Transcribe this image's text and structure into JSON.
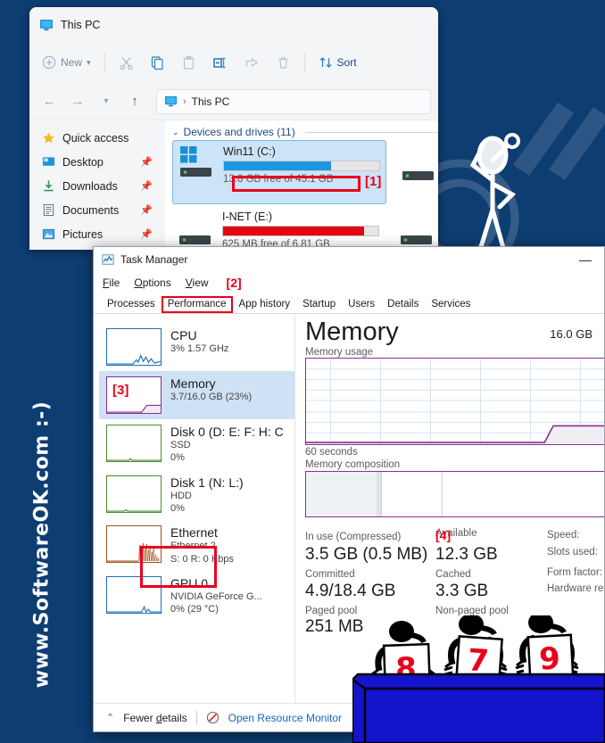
{
  "background": {
    "color": "#0e3d72",
    "watermark_vertical": "www.SoftwareOK.com  :-)"
  },
  "explorer": {
    "title": "This PC",
    "title_icon": "monitor-icon",
    "toolbar": {
      "new_label": "New",
      "new_icon": "plus-circle-icon",
      "new_chevron": "chevron-down-icon",
      "cut_icon": "scissors-icon",
      "copy_icon": "copy-icon",
      "paste_icon": "clipboard-icon",
      "rename_icon": "rename-icon",
      "share_icon": "share-icon",
      "delete_icon": "trash-icon",
      "sort_label": "Sort",
      "sort_icon": "sort-arrows-icon"
    },
    "nav": {
      "back_icon": "arrow-left-icon",
      "forward_icon": "arrow-right-icon",
      "recent_icon": "chevron-down-icon",
      "up_icon": "arrow-up-icon",
      "address_icon": "monitor-icon",
      "address_separator": "›",
      "address_text": "This PC"
    },
    "sidebar": [
      {
        "label": "Quick access",
        "icon": "star-icon",
        "pinned": false
      },
      {
        "label": "Desktop",
        "icon": "desktop-icon",
        "pinned": true
      },
      {
        "label": "Downloads",
        "icon": "download-icon",
        "pinned": true
      },
      {
        "label": "Documents",
        "icon": "document-icon",
        "pinned": true
      },
      {
        "label": "Pictures",
        "icon": "pictures-icon",
        "pinned": true
      }
    ],
    "content": {
      "group_heading": "Devices and drives (11)",
      "group_chevron": "chevron-down-icon",
      "drives": [
        {
          "name": "Win11 (C:)",
          "free_text": "13.8 GB free of 45.1 GB",
          "used_percent": 69,
          "bar_color": "#1e97e0",
          "icon": "windows-drive-icon",
          "selected": true,
          "marker": "[1]"
        },
        {
          "name": "I-NET (E:)",
          "free_text": "625 MB free of 6.81 GB",
          "used_percent": 91,
          "bar_color": "#e30613",
          "icon": "hdd-icon",
          "selected": false,
          "marker": ""
        }
      ]
    }
  },
  "taskmanager": {
    "title": "Task Manager",
    "title_icon": "taskmanager-icon",
    "minimize_glyph": "—",
    "menus": [
      {
        "label": "File",
        "accel": "F"
      },
      {
        "label": "Options",
        "accel": "O"
      },
      {
        "label": "View",
        "accel": "V"
      }
    ],
    "menu_marker": "[2]",
    "tabs": [
      {
        "label": "Processes",
        "highlight": false
      },
      {
        "label": "Performance",
        "highlight": true
      },
      {
        "label": "App history",
        "highlight": false
      },
      {
        "label": "Startup",
        "highlight": false
      },
      {
        "label": "Users",
        "highlight": false
      },
      {
        "label": "Details",
        "highlight": false
      },
      {
        "label": "Services",
        "highlight": false
      }
    ],
    "resources": [
      {
        "title": "CPU",
        "sub1": "3%  1.57 GHz",
        "sub2": "",
        "color": "#1e6fb8",
        "active": false,
        "marker": ""
      },
      {
        "title": "Memory",
        "sub1": "3.7/16.0 GB (23%)",
        "sub2": "",
        "color": "#8a2f8f",
        "active": true,
        "marker": "[3]"
      },
      {
        "title": "Disk 0 (D: E: F: H: C",
        "sub1": "SSD",
        "sub2": "0%",
        "color": "#4b8b2f",
        "active": false,
        "marker": ""
      },
      {
        "title": "Disk 1 (N: L:)",
        "sub1": "HDD",
        "sub2": "0%",
        "color": "#4b8b2f",
        "active": false,
        "marker": ""
      },
      {
        "title": "Ethernet",
        "sub1": "Ethernet 2",
        "sub2": "S: 0 R: 0 Kbps",
        "color": "#a0521e",
        "active": false,
        "marker": ""
      },
      {
        "title": "GPU 0",
        "sub1": "NVIDIA GeForce G...",
        "sub2": "0%  (29 °C)",
        "color": "#1e6fb8",
        "active": false,
        "marker": ""
      }
    ],
    "memory_panel": {
      "heading": "Memory",
      "total": "16.0 GB",
      "usage_label": "Memory usage",
      "usage_axis_right": "60 seconds",
      "composition_label": "Memory composition",
      "stats": [
        {
          "label": "In use (Compressed)",
          "value": "3.5 GB (0.5 MB)"
        },
        {
          "label": "Available",
          "value": "12.3 GB"
        },
        {
          "label": "Committed",
          "value": "4.9/18.4 GB"
        },
        {
          "label": "Cached",
          "value": "3.3 GB"
        },
        {
          "label": "Paged pool",
          "value": "251 MB"
        },
        {
          "label": "Non-paged pool",
          "value": ""
        }
      ],
      "stat_marker": "[4]",
      "specs": [
        {
          "label": "Speed:",
          "value": ""
        },
        {
          "label": "Slots used:",
          "value": ""
        },
        {
          "label": "Form factor:",
          "value": ""
        },
        {
          "label": "Hardware reserved:",
          "value": ""
        }
      ]
    },
    "statusbar": {
      "fewer_details": "Fewer details",
      "fewer_details_icon": "chevron-up-icon",
      "resource_monitor": "Open Resource Monitor",
      "resource_monitor_icon": "resource-monitor-icon"
    }
  },
  "judges": {
    "scores": [
      "8",
      "7",
      "9"
    ],
    "table_color": "#1414cc"
  }
}
